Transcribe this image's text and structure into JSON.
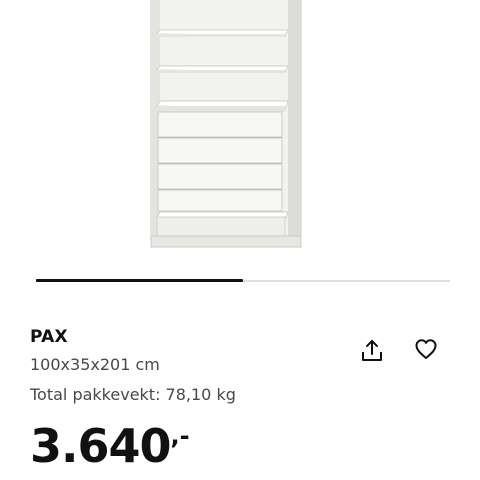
{
  "product": {
    "name": "PAX",
    "dimensions": "100x35x201 cm",
    "weight": "Total pakkevekt: 78,10 kg"
  },
  "price": {
    "amount": "3.640",
    "suffix": ",-"
  },
  "carousel": {
    "progress": 0.5
  },
  "icons": {
    "share": "share-icon",
    "favourite": "heart-icon"
  },
  "colors": {
    "text": "#111111",
    "secondary_text": "#484848",
    "track": "#dfdfdf"
  }
}
